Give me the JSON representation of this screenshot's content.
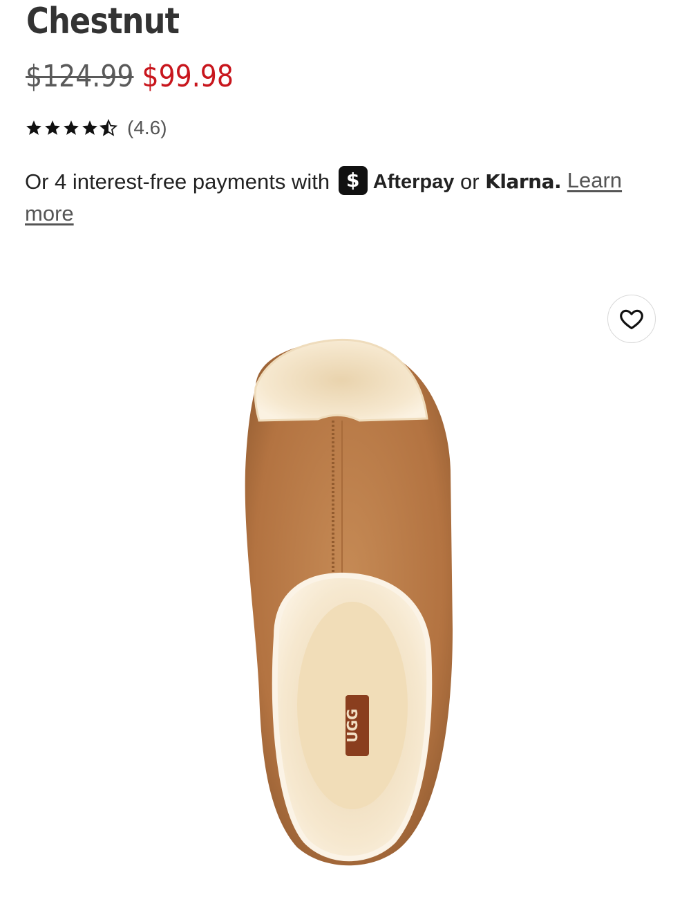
{
  "product": {
    "title": "Chestnut",
    "original_price": "$124.99",
    "sale_price": "$99.98",
    "rating": 4.6,
    "rating_label": "(4.6)",
    "image_label": "UGG"
  },
  "payment": {
    "prefix": "Or 4 interest-free payments with",
    "afterpay_icon": "$",
    "afterpay_name": "Afterpay",
    "or": "or",
    "klarna_name": "Klarna.",
    "learn_more": "Learn more"
  },
  "colors": {
    "sale_price": "#c8161d",
    "original_price": "#5a5a5a",
    "suede": "#b97a45",
    "fur": "#f3e2c4"
  },
  "icons": {
    "favorite": "heart-outline-icon",
    "rating": "star-icon"
  }
}
